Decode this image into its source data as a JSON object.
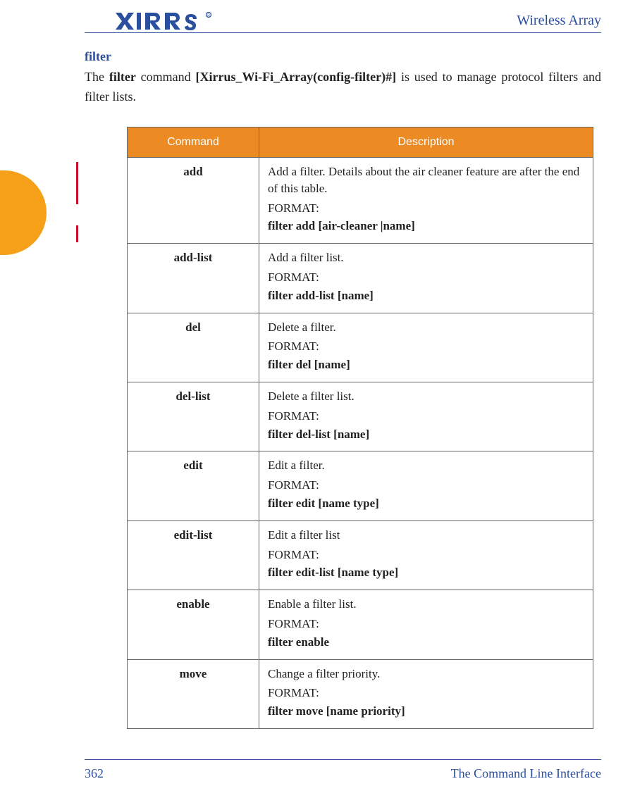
{
  "header": {
    "doc_title": "Wireless Array",
    "logo_text": "XIRRUS"
  },
  "section": {
    "title": "filter",
    "intro_pre": "The ",
    "intro_bold1": "filter",
    "intro_mid": " command ",
    "intro_bold2": "[Xirrus_Wi-Fi_Array(config-filter)#]",
    "intro_post": " is used to manage protocol filters and filter lists."
  },
  "table": {
    "headers": {
      "command": "Command",
      "description": "Description"
    },
    "format_label": "FORMAT:",
    "rows": [
      {
        "command": "add",
        "description": "Add a filter. Details about the air cleaner feature are after the end of this table.",
        "syntax": "filter add [air-cleaner |name]"
      },
      {
        "command": "add-list",
        "description": "Add a filter list.",
        "syntax": "filter add-list [name]"
      },
      {
        "command": "del",
        "description": "Delete a filter.",
        "syntax": "filter del [name]"
      },
      {
        "command": "del-list",
        "description": "Delete a filter list.",
        "syntax": "filter del-list [name]"
      },
      {
        "command": "edit",
        "description": "Edit a filter.",
        "syntax": "filter edit [name type]"
      },
      {
        "command": "edit-list",
        "description": "Edit a filter list",
        "syntax": "filter edit-list [name type]"
      },
      {
        "command": "enable",
        "description": "Enable a filter list.",
        "syntax": "filter enable"
      },
      {
        "command": "move",
        "description": "Change a filter priority.",
        "syntax": "filter move [name priority]"
      }
    ]
  },
  "footer": {
    "page_number": "362",
    "section_title": "The Command Line Interface"
  }
}
